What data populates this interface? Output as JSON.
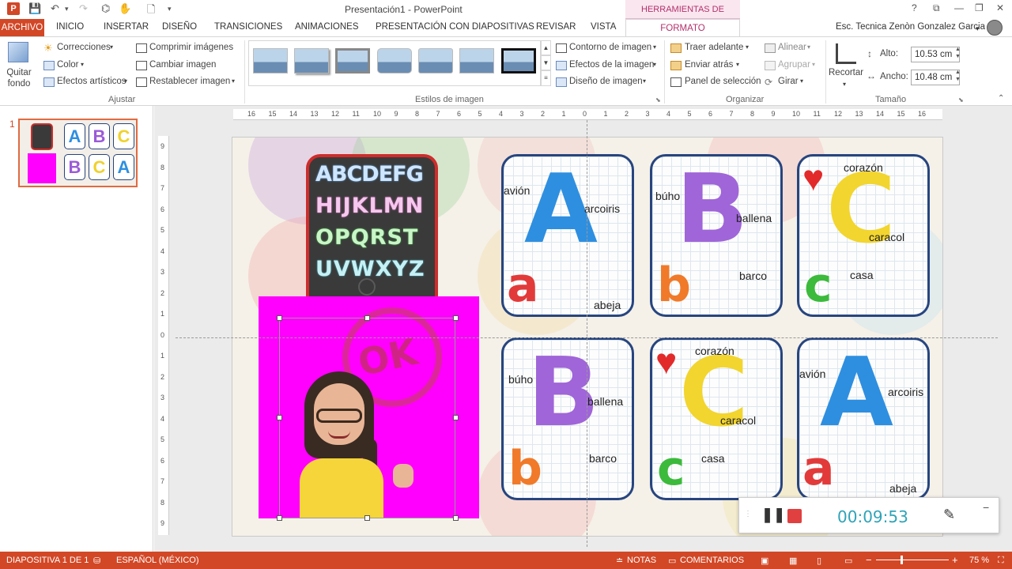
{
  "window": {
    "title": "Presentación1 - PowerPoint",
    "context_tab_group": "HERRAMIENTAS DE IMAGEN",
    "controls": [
      "?",
      "⧉",
      "—",
      "❐",
      "✕"
    ]
  },
  "tabs": [
    {
      "label": "ARCHIVO"
    },
    {
      "label": "INICIO"
    },
    {
      "label": "INSERTAR"
    },
    {
      "label": "DISEÑO"
    },
    {
      "label": "TRANSICIONES"
    },
    {
      "label": "ANIMACIONES"
    },
    {
      "label": "PRESENTACIÓN CON DIAPOSITIVAS"
    },
    {
      "label": "REVISAR"
    },
    {
      "label": "VISTA"
    },
    {
      "label": "FORMATO"
    }
  ],
  "user": {
    "name": "Esc. Tecnica Zenòn Gonzalez Garcia"
  },
  "ribbon": {
    "ajustar": {
      "label": "Ajustar",
      "quitar_fondo": "Quitar fondo",
      "correcciones": "Correcciones",
      "color": "Color",
      "efectos_artisticos": "Efectos artísticos",
      "comprimir": "Comprimir imágenes",
      "cambiar": "Cambiar imagen",
      "restablecer": "Restablecer imagen"
    },
    "estilos": {
      "label": "Estilos de imagen",
      "contorno": "Contorno de imagen",
      "efectos": "Efectos de la imagen",
      "diseno": "Diseño de imagen"
    },
    "organizar": {
      "label": "Organizar",
      "traer": "Traer adelante",
      "enviar": "Enviar atrás",
      "panel": "Panel de selección",
      "alinear": "Alinear",
      "agrupar": "Agrupar",
      "girar": "Girar"
    },
    "tamano": {
      "label": "Tamaño",
      "recortar": "Recortar",
      "alto_label": "Alto:",
      "alto_value": "10.53 cm",
      "ancho_label": "Ancho:",
      "ancho_value": "10.48 cm"
    }
  },
  "thumbnail": {
    "number": "1"
  },
  "hruler_ticks": [
    "16",
    "15",
    "14",
    "13",
    "12",
    "11",
    "10",
    "9",
    "8",
    "7",
    "6",
    "5",
    "4",
    "3",
    "2",
    "1",
    "0",
    "1",
    "2",
    "3",
    "4",
    "5",
    "6",
    "7",
    "8",
    "9",
    "10",
    "11",
    "12",
    "13",
    "14",
    "15",
    "16"
  ],
  "vruler_ticks": [
    "9",
    "8",
    "7",
    "6",
    "5",
    "4",
    "3",
    "2",
    "1",
    "0",
    "1",
    "2",
    "3",
    "4",
    "5",
    "6",
    "7",
    "8",
    "9"
  ],
  "slide": {
    "alphabet_rows": [
      "ABCDEFG",
      "HIJKLMN",
      "OPQRST",
      "UVWXYZ"
    ],
    "stamp": "OK",
    "cards": [
      {
        "big": "A",
        "small": "a",
        "words": [
          "avión",
          "arcoiris",
          "abeja"
        ]
      },
      {
        "big": "B",
        "small": "b",
        "words": [
          "búho",
          "ballena",
          "barco"
        ]
      },
      {
        "big": "C",
        "small": "c",
        "words": [
          "corazón",
          "caracol",
          "casa"
        ]
      },
      {
        "big": "B",
        "small": "b",
        "words": [
          "búho",
          "ballena",
          "barco"
        ]
      },
      {
        "big": "C",
        "small": "c",
        "words": [
          "corazón",
          "caracol",
          "casa"
        ]
      },
      {
        "big": "A",
        "small": "a",
        "words": [
          "avión",
          "arcoiris",
          "abeja"
        ]
      }
    ]
  },
  "recorder": {
    "time": "00:09:53"
  },
  "status": {
    "slide": "DIAPOSITIVA 1 DE 1",
    "language": "ESPAÑOL (MÉXICO)",
    "notas": "NOTAS",
    "comentarios": "COMENTARIOS",
    "zoom": "75 %"
  },
  "colors": {
    "accent": "#d24726",
    "format_tab": "#b4306b",
    "recorder_time": "#2fa3b8",
    "stop": "#e04040"
  }
}
